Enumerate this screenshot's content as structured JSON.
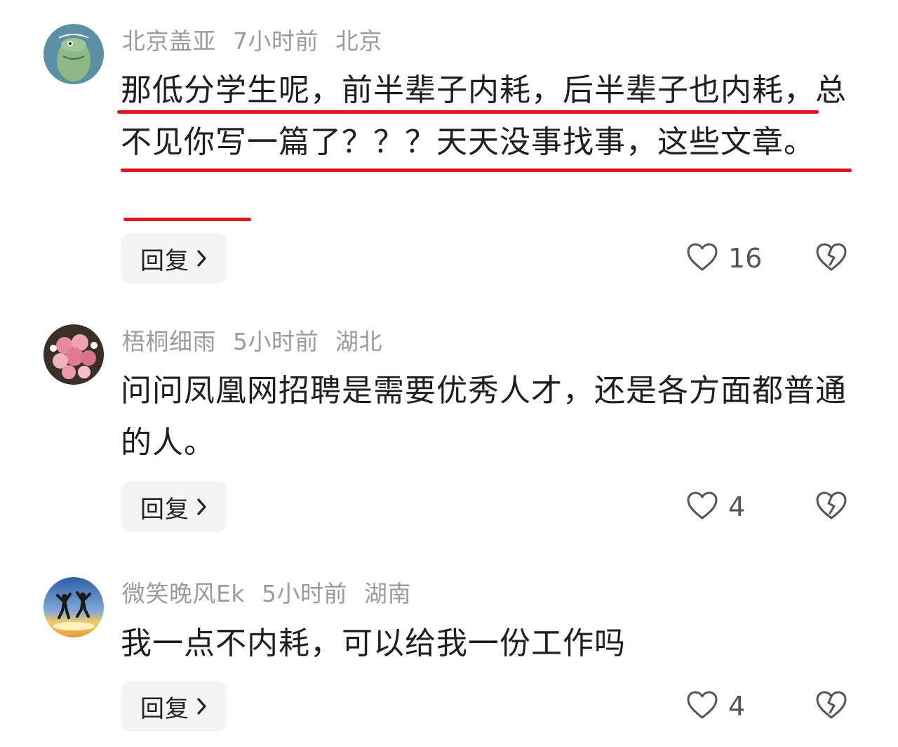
{
  "comments": [
    {
      "username": "北京盖亚",
      "time": "7小时前",
      "location": "北京",
      "text": "那低分学生呢，前半辈子内耗，后半辈子也内耗，总不见你写一篇了？？？天天没事找事，这些文章。",
      "reply_label": "回复",
      "likes": "16",
      "avatar_icon": "green-cartoon-avatar"
    },
    {
      "username": "梧桐细雨",
      "time": "5小时前",
      "location": "湖北",
      "text": "问问凤凰网招聘是需要优秀人才，还是各方面都普通的人。",
      "reply_label": "回复",
      "likes": "4",
      "avatar_icon": "pink-flowers-avatar"
    },
    {
      "username": "微笑晚风Ek",
      "time": "5小时前",
      "location": "湖南",
      "text": "我一点不内耗，可以给我一份工作吗",
      "reply_label": "回复",
      "likes": "4",
      "avatar_icon": "sunset-jumping-people-avatar"
    }
  ],
  "colors": {
    "highlight_underline": "#e0141e",
    "meta_gray": "#9b9b9b",
    "button_bg": "#f4f4f4"
  }
}
